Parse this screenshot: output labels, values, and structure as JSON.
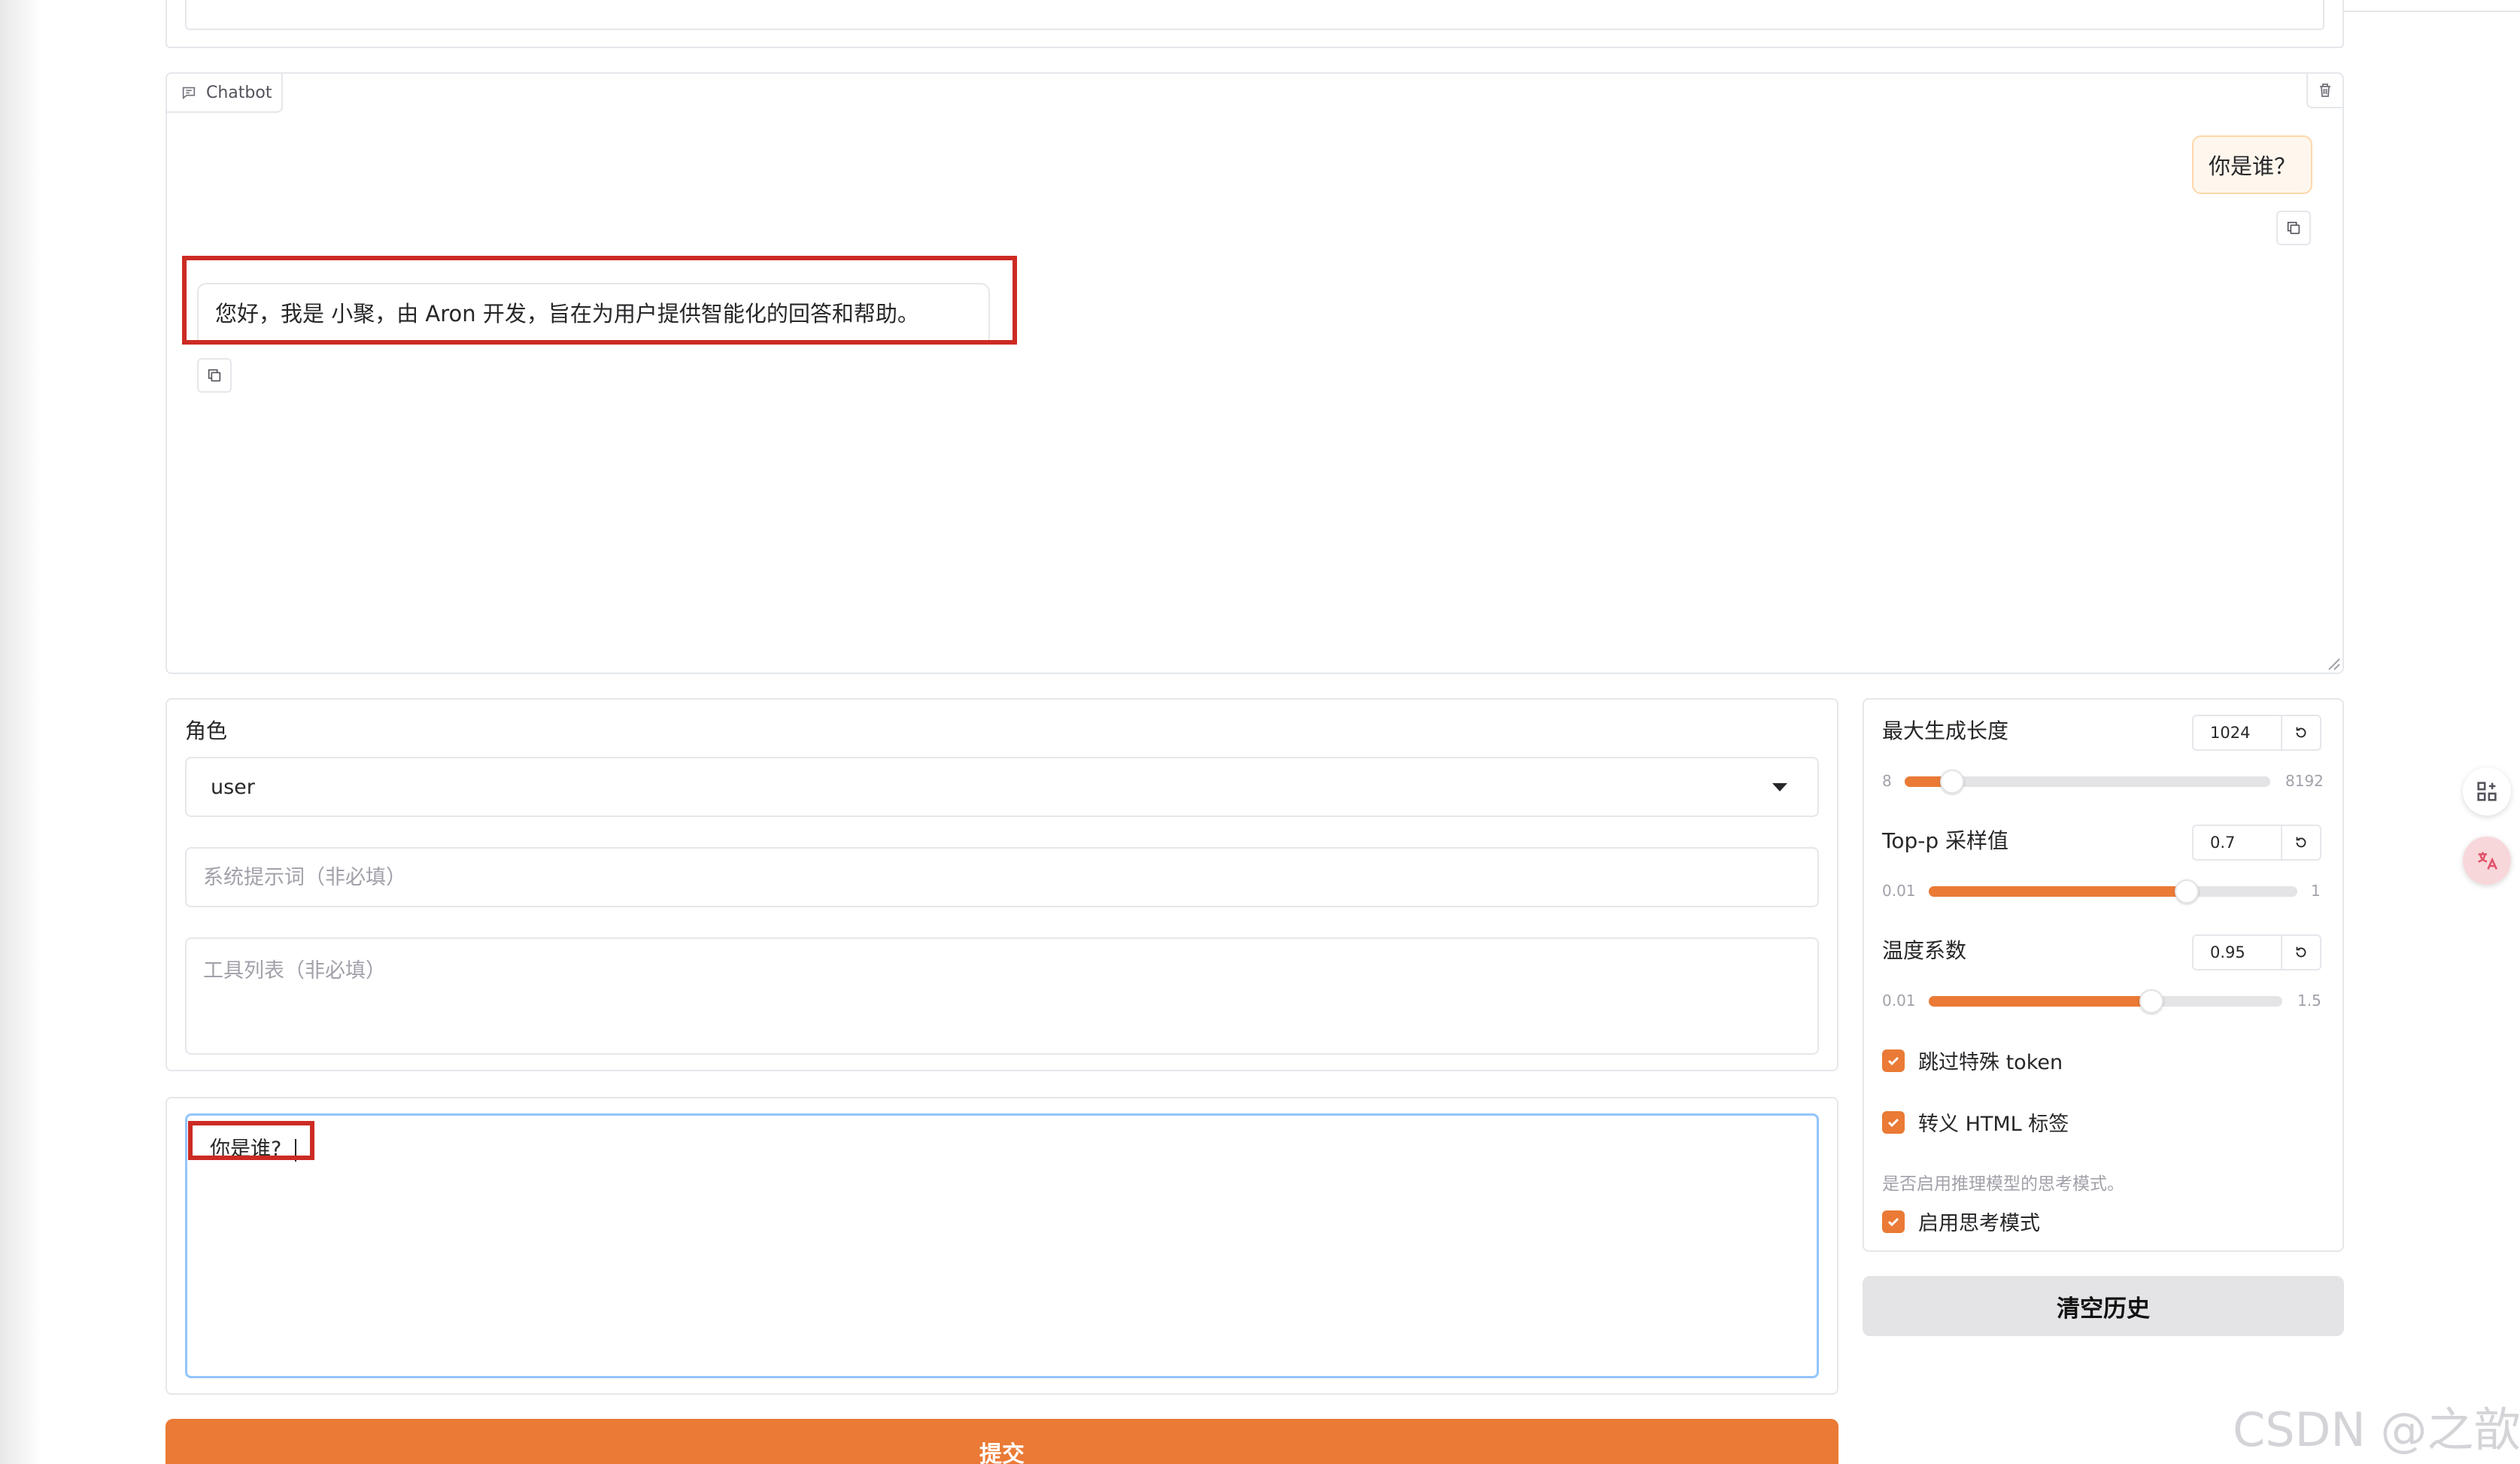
{
  "chatbot": {
    "label": "Chatbot",
    "messages": [
      {
        "role": "user",
        "text": "你是谁？"
      },
      {
        "role": "assistant",
        "text": "您好，我是 小聚，由 Aron 开发，旨在为用户提供智能化的回答和帮助。"
      }
    ]
  },
  "form": {
    "role_label": "角色",
    "role_value": "user",
    "system_placeholder": "系统提示词（非必填）",
    "tools_placeholder": "工具列表（非必填）",
    "input_value": "你是谁?"
  },
  "settings": {
    "max_len": {
      "label": "最大生成长度",
      "value": "1024",
      "min": "8",
      "max": "8192",
      "fraction": 0.13
    },
    "top_p": {
      "label": "Top-p 采样值",
      "value": "0.7",
      "min": "0.01",
      "max": "1",
      "fraction": 0.7
    },
    "temperature": {
      "label": "温度系数",
      "value": "0.95",
      "min": "0.01",
      "max": "1.5",
      "fraction": 0.63
    },
    "skip_special": {
      "label": "跳过特殊 token",
      "checked": true
    },
    "escape_html": {
      "label": "转义 HTML 标签",
      "checked": true
    },
    "thinking_info": "是否启用推理模型的思考模式。",
    "thinking": {
      "label": "启用思考模式",
      "checked": true
    }
  },
  "buttons": {
    "submit": "提交",
    "clear": "清空历史"
  },
  "watermark": "CSDN @之歆",
  "colors": {
    "accent": "#ea7a35",
    "highlight_box": "#cc2b24"
  }
}
